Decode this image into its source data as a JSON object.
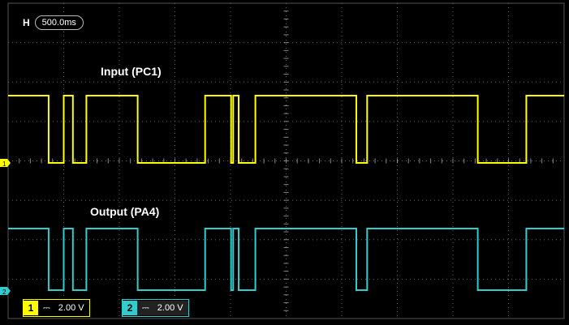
{
  "timebase": {
    "label": "H",
    "value": "500.0ms"
  },
  "labels": {
    "input": "Input (PC1)",
    "output": "Output (PA4)"
  },
  "channels": [
    {
      "num": "1",
      "coupling": "⎓",
      "scale": "2.00 V",
      "color": "#ffff00"
    },
    {
      "num": "2",
      "coupling": "⎓",
      "scale": "2.00 V",
      "color": "#33cccc"
    }
  ],
  "colors": {
    "grid": "#666666",
    "background": "#000000",
    "ch1": "#ffff00",
    "ch2": "#33cccc"
  },
  "signal_edges_ms": [
    0,
    750,
    1030,
    1200,
    1450,
    2400,
    3650,
    4130,
    4170,
    4270,
    4580,
    6450,
    6650,
    8700,
    9600,
    10300
  ],
  "time_window_ms": [
    0,
    10300
  ]
}
